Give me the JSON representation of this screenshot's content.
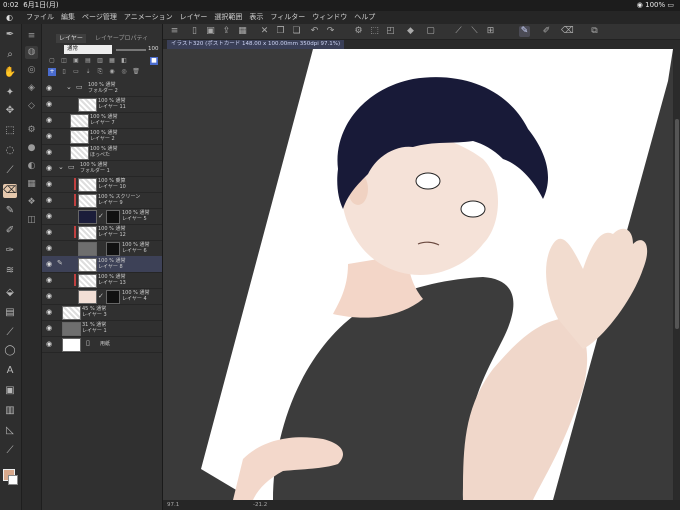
{
  "status_bar": {
    "time": "0:02",
    "date": "6月1日(月)",
    "battery": "100%"
  },
  "menu": [
    "ファイル",
    "編集",
    "ページ管理",
    "アニメーション",
    "レイヤー",
    "選択範囲",
    "表示",
    "フィルター",
    "ウィンドウ",
    "ヘルプ"
  ],
  "document_tab": "イラスト320 (ポストカード 148.00 x 100.00mm 350dpi 97.1%)",
  "layer_panel": {
    "tabs": [
      "レイヤー",
      "レイヤープロパティ"
    ],
    "blend_mode": "通常",
    "opacity": "100"
  },
  "layers": [
    {
      "line1": "100 % 通常",
      "line2": "フォルダー 2",
      "kind": "folder"
    },
    {
      "line1": "100 % 通常",
      "line2": "レイヤー 11",
      "kind": "checker"
    },
    {
      "line1": "100 % 通常",
      "line2": "レイヤー 7",
      "kind": "checker"
    },
    {
      "line1": "100 % 通常",
      "line2": "レイヤー 2",
      "kind": "checker"
    },
    {
      "line1": "100 % 通常",
      "line2": "ほっぺた",
      "kind": "checker"
    },
    {
      "line1": "100 % 通常",
      "line2": "フォルダー 1",
      "kind": "folder"
    },
    {
      "line1": "100 % 乗算",
      "line2": "レイヤー 10",
      "kind": "checker"
    },
    {
      "line1": "100 % スクリーン",
      "line2": "レイヤー 9",
      "kind": "checker"
    },
    {
      "line1": "100 % 通常",
      "line2": "レイヤー 5",
      "kind": "dark"
    },
    {
      "line1": "100 % 通常",
      "line2": "レイヤー 12",
      "kind": "checker"
    },
    {
      "line1": "100 % 通常",
      "line2": "レイヤー 6",
      "kind": "grey"
    },
    {
      "line1": "100 % 通常",
      "line2": "レイヤー 8",
      "kind": "checker"
    },
    {
      "line1": "100 % 通常",
      "line2": "レイヤー 13",
      "kind": "checker"
    },
    {
      "line1": "100 % 通常",
      "line2": "レイヤー 4",
      "kind": "skin"
    },
    {
      "line1": "45 % 通常",
      "line2": "レイヤー 3",
      "kind": "checker"
    },
    {
      "line1": "31 % 通常",
      "line2": "レイヤー 1",
      "kind": "grey"
    },
    {
      "line1": "",
      "line2": "用紙",
      "kind": "paper"
    }
  ],
  "bottom_bar": {
    "zoom": "97.1",
    "angle": "-21.2"
  },
  "colors": {
    "accent": "#4a6ccf",
    "selected_tool": "#e7c9ad",
    "selected_layer": "#3d4157",
    "main_color": "#d9a98c"
  }
}
